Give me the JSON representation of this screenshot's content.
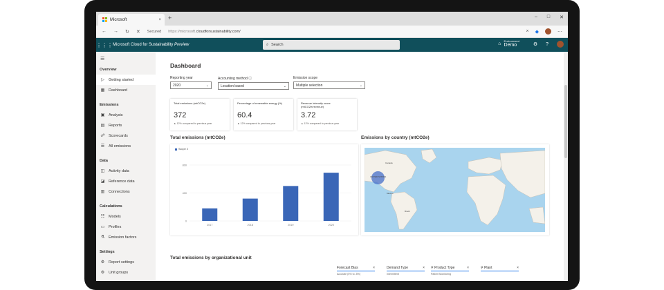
{
  "browser": {
    "tab_title": "Microsoft",
    "tab_close": "×",
    "new_tab": "+",
    "window_controls": [
      "–",
      "□",
      "✕"
    ],
    "nav": [
      "←",
      "→",
      "↻",
      "✕"
    ],
    "secured": "Secured",
    "url_prefix": "https://microsoft.",
    "url_domain": "cloudforsustainability.com/",
    "clear": "×"
  },
  "app": {
    "title": "Microsoft Cloud for Sustainability",
    "title_suffix": "Preview",
    "search_placeholder": "Search",
    "environment_label": "Environment",
    "environment_value": "Demo",
    "help": "?"
  },
  "sidebar": {
    "sections": [
      {
        "title": "Overview",
        "items": [
          {
            "label": "Getting started",
            "icon": "play-icon",
            "glyph": "▷",
            "active": true
          },
          {
            "label": "Dashboard",
            "icon": "dashboard-icon",
            "glyph": "▦"
          }
        ]
      },
      {
        "title": "Emissions",
        "items": [
          {
            "label": "Analysis",
            "icon": "analysis-icon",
            "glyph": "▣"
          },
          {
            "label": "Reports",
            "icon": "reports-icon",
            "glyph": "▤"
          },
          {
            "label": "Scorecards",
            "icon": "scorecards-icon",
            "glyph": "☍"
          },
          {
            "label": "All emissions",
            "icon": "list-icon",
            "glyph": "☰"
          }
        ]
      },
      {
        "title": "Data",
        "items": [
          {
            "label": "Activity data",
            "icon": "activity-icon",
            "glyph": "◫"
          },
          {
            "label": "Reference data",
            "icon": "reference-icon",
            "glyph": "◪"
          },
          {
            "label": "Connections",
            "icon": "connections-icon",
            "glyph": "▥"
          }
        ]
      },
      {
        "title": "Calculations",
        "items": [
          {
            "label": "Models",
            "icon": "models-icon",
            "glyph": "☷"
          },
          {
            "label": "Profiles",
            "icon": "profiles-icon",
            "glyph": "▭"
          },
          {
            "label": "Emission factors",
            "icon": "factors-icon",
            "glyph": "⚗"
          }
        ]
      },
      {
        "title": "Settings",
        "items": [
          {
            "label": "Report settings",
            "icon": "gear-icon",
            "glyph": "⚙"
          },
          {
            "label": "Unit groups",
            "icon": "units-icon",
            "glyph": "⚙"
          }
        ]
      }
    ]
  },
  "dashboard": {
    "title": "Dashboard",
    "filters": [
      {
        "label": "Reporting year",
        "value": "2020"
      },
      {
        "label": "Accounting method",
        "value": "Location based",
        "info": "ⓘ"
      },
      {
        "label": "Emission scope",
        "value": "Multiple selection"
      }
    ],
    "kpis": [
      {
        "label": "Total emissions (mtCO2e)",
        "value": "372",
        "trend": "▲ 12% compared to previous year"
      },
      {
        "label": "Percentage of renewable energy (%)",
        "value": "60.4",
        "trend": "▲ 12% compared to previous year"
      },
      {
        "label": "Revenue intensity score (mtCO2e/revenue)",
        "value": "3.72",
        "trend": "▲ 12% compared to previous year"
      }
    ],
    "total_emissions_title": "Total emissions (mtCO2e)",
    "by_country_title": "Emissions by country (mtCO2e)",
    "by_unit_title": "Total emissions by organizational unit",
    "map_labels": [
      "UNITED STATES",
      "Mexico",
      "Brazil",
      "Canada"
    ],
    "filter_cards": [
      {
        "title": "Forecast Bias",
        "sub": "Accurate (5% to -5%)"
      },
      {
        "title": "Demand Type",
        "sub": "Intermittent"
      },
      {
        "title": "Product Type",
        "sub": "Patient Monitoring"
      },
      {
        "title": "Plant",
        "sub": ""
      }
    ]
  },
  "chart_data": {
    "type": "bar",
    "categories": [
      "2017",
      "2018",
      "2019",
      "2020"
    ],
    "series": [
      {
        "name": "Scope 2",
        "values": [
          180,
          320,
          500,
          690
        ]
      }
    ],
    "yticks": [
      "0",
      "400",
      "800"
    ],
    "ylim": [
      0,
      800
    ],
    "color": "#3a66b7"
  }
}
